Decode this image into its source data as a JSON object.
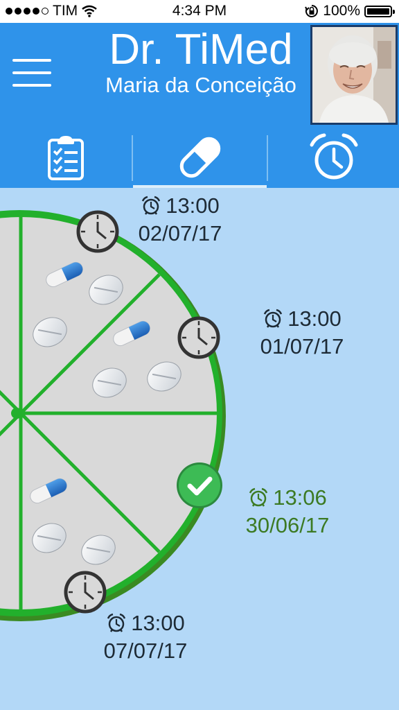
{
  "status": {
    "carrier": "TIM",
    "time": "4:34 PM",
    "battery": "100%",
    "icons": [
      "signal-dots",
      "wifi-icon",
      "orientation-lock-icon",
      "battery-icon"
    ]
  },
  "header": {
    "title": "Dr. TiMed",
    "patient_name": "Maria da Conceição",
    "menu_icon": "hamburger-menu-icon",
    "avatar": "patient-photo"
  },
  "tabs": [
    {
      "icon": "clipboard-checklist-icon",
      "active": false
    },
    {
      "icon": "pill-capsule-icon",
      "active": true
    },
    {
      "icon": "alarm-clock-icon",
      "active": false
    }
  ],
  "colors": {
    "header_bg": "#2f93ea",
    "page_bg": "#b3d8f7",
    "wheel_green": "#22b02c",
    "compartment_gray": "#d9d9d9",
    "done_green": "#3c7a23"
  },
  "doses": [
    {
      "time": "13:00",
      "date": "02/07/17",
      "status": "pending"
    },
    {
      "time": "13:00",
      "date": "01/07/17",
      "status": "pending"
    },
    {
      "time": "13:06",
      "date": "30/06/17",
      "status": "taken"
    },
    {
      "time": "13:00",
      "date": "07/07/17",
      "status": "pending"
    }
  ]
}
